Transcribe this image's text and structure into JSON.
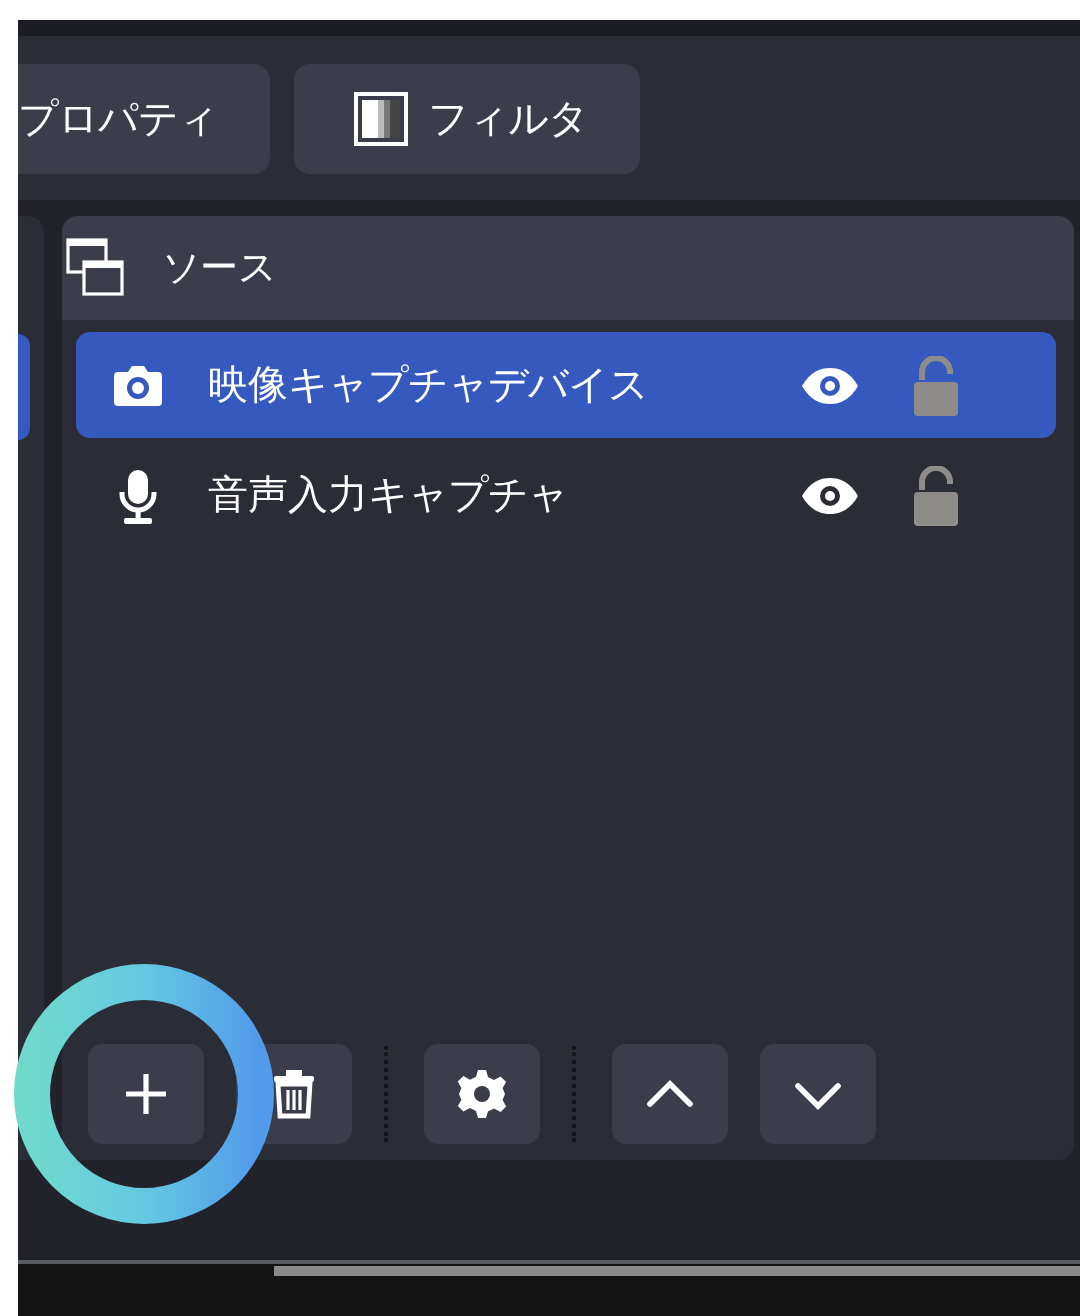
{
  "toolbar": {
    "buttons": [
      {
        "label": "プロパティ",
        "kind": "plain"
      },
      {
        "label": "フィルタ",
        "kind": "filter"
      }
    ]
  },
  "sources": {
    "title": "ソース",
    "items": [
      {
        "name": "映像キャプチャデバイス",
        "kind": "camera",
        "selected": true,
        "visible": true,
        "locked": false
      },
      {
        "name": "音声入力キャプチャ",
        "kind": "mic",
        "selected": false,
        "visible": true,
        "locked": false
      }
    ],
    "controls": [
      {
        "kind": "add"
      },
      {
        "kind": "remove"
      },
      {
        "kind": "separator"
      },
      {
        "kind": "settings"
      },
      {
        "kind": "separator"
      },
      {
        "kind": "up"
      },
      {
        "kind": "down"
      }
    ]
  }
}
